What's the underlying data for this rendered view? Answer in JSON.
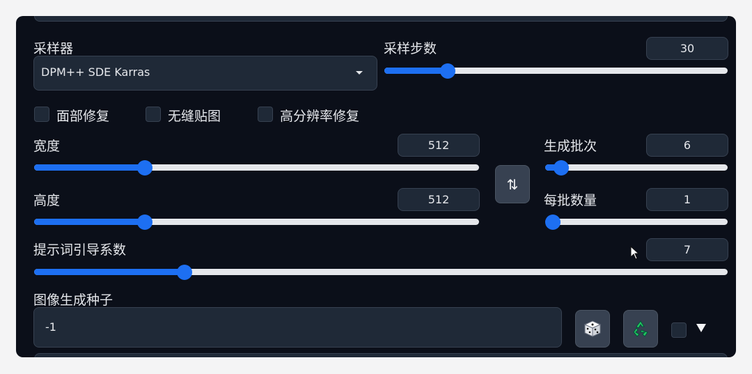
{
  "sampler": {
    "label": "采样器",
    "value": "DPM++ SDE Karras",
    "icon": "chevron-down-icon"
  },
  "steps": {
    "label": "采样步数",
    "value": "30",
    "fraction": 0.17
  },
  "options": [
    {
      "label": "面部修复",
      "checked": false
    },
    {
      "label": "无缝贴图",
      "checked": false
    },
    {
      "label": "高分辨率修复",
      "checked": false
    }
  ],
  "width": {
    "label": "宽度",
    "value": "512",
    "fraction": 0.24
  },
  "height": {
    "label": "高度",
    "value": "512",
    "fraction": 0.24
  },
  "swap": {
    "icon": "swap-arrows-icon",
    "glyph": "⇅"
  },
  "batch_count": {
    "label": "生成批次",
    "value": "6",
    "fraction": 0.05
  },
  "batch_size": {
    "label": "每批数量",
    "value": "1",
    "fraction": 0.0
  },
  "cfg": {
    "label": "提示词引导系数",
    "value": "7",
    "fraction": 0.21
  },
  "seed": {
    "label": "图像生成种子",
    "value": "-1",
    "random_icon": "dice-icon",
    "reuse_icon": "recycle-icon",
    "extra_glyph": "▼"
  },
  "colors": {
    "accent": "#1d6ff2",
    "panel": "#0b0f19",
    "input": "#1f2937"
  }
}
